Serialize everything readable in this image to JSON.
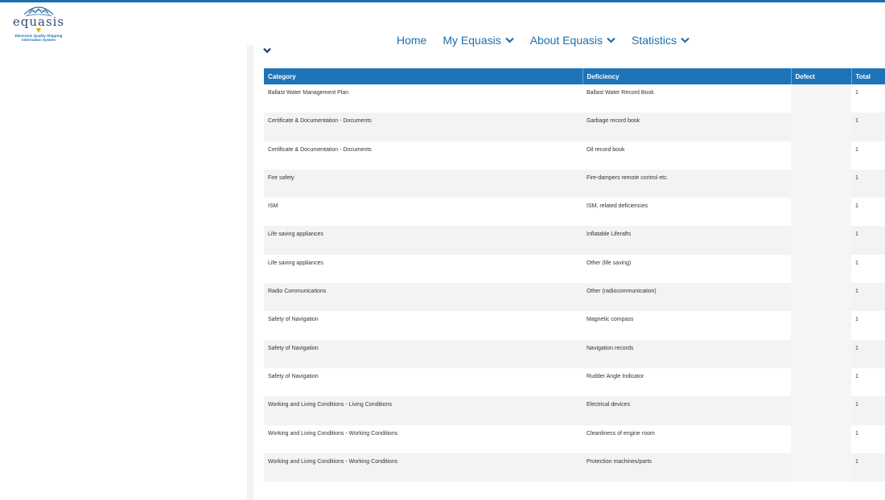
{
  "logo": {
    "wordmark": "equasis",
    "tagline_line1": "Electronic Quality Shipping",
    "tagline_line2": "Information System"
  },
  "nav": {
    "items": [
      {
        "label": "Home",
        "has_dropdown": false
      },
      {
        "label": "My Equasis",
        "has_dropdown": true
      },
      {
        "label": "About Equasis",
        "has_dropdown": true
      },
      {
        "label": "Statistics",
        "has_dropdown": true
      }
    ]
  },
  "table": {
    "headers": [
      "Category",
      "Deficiency",
      "Defect",
      "Total"
    ],
    "rows": [
      [
        "Ballast Water Management Plan",
        "Ballast Water Record Book",
        "",
        "1"
      ],
      [
        "Certificate & Documentation - Documents",
        "Garbage record book",
        "",
        "1"
      ],
      [
        "Certificate & Documentation - Documents",
        "Oil record book",
        "",
        "1"
      ],
      [
        "Fire safety",
        "Fire-dampers remote control etc.",
        "",
        "1"
      ],
      [
        "ISM",
        "ISM, related deficiencies",
        "",
        "1"
      ],
      [
        "Life saving appliances",
        "Inflatable Liferafts",
        "",
        "1"
      ],
      [
        "Life saving appliances",
        "Other (life saving)",
        "",
        "1"
      ],
      [
        "Radio Communications",
        "Other (radiocommunication)",
        "",
        "1"
      ],
      [
        "Safety of Navigation",
        "Magnetic compass",
        "",
        "1"
      ],
      [
        "Safety of Navigation",
        "Navigation records",
        "",
        "1"
      ],
      [
        "Safety of Navigation",
        "Rudder Angle Indicator",
        "",
        "1"
      ],
      [
        "Working and Living Conditions - Living Conditions",
        "Electrical devices",
        "",
        "1"
      ],
      [
        "Working and Living Conditions - Working Conditions",
        "Cleanliness of engine room",
        "",
        "1"
      ],
      [
        "Working and Living Conditions - Working Conditions",
        "Protection machines/parts",
        "",
        "1"
      ]
    ]
  },
  "colors": {
    "brand_blue": "#1b6fae",
    "header_blue": "#1f74b8",
    "row_stripe": "#f3f3f3",
    "logo_accent": "#e8a600"
  },
  "icons": {
    "nav_dropdown": "chevron-down-icon",
    "section_toggle": "chevron-down-icon",
    "logo": "equasis-logo"
  }
}
